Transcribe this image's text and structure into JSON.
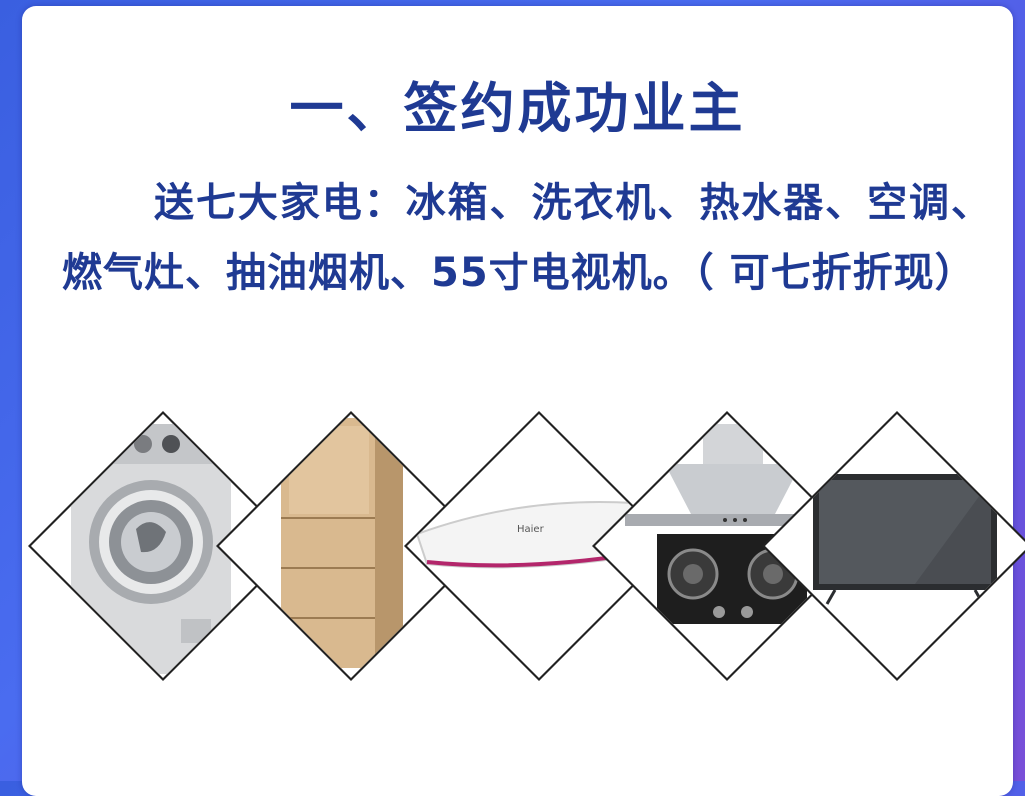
{
  "slide": {
    "title": "一、签约成功业主",
    "description": "送七大家电：冰箱、洗衣机、热水器、空调、燃气灶、抽油烟机、55寸电视机。（ 可七折折现）"
  },
  "appliances": [
    {
      "icon": "washing-machine-icon"
    },
    {
      "icon": "refrigerator-icon"
    },
    {
      "icon": "air-conditioner-icon"
    },
    {
      "icon": "range-hood-gas-stove-icon"
    },
    {
      "icon": "television-icon"
    }
  ],
  "colors": {
    "title_text": "#1f3a93",
    "background_gradient": [
      "#3a5fe0",
      "#7a4fd8"
    ],
    "card": "#ffffff"
  }
}
